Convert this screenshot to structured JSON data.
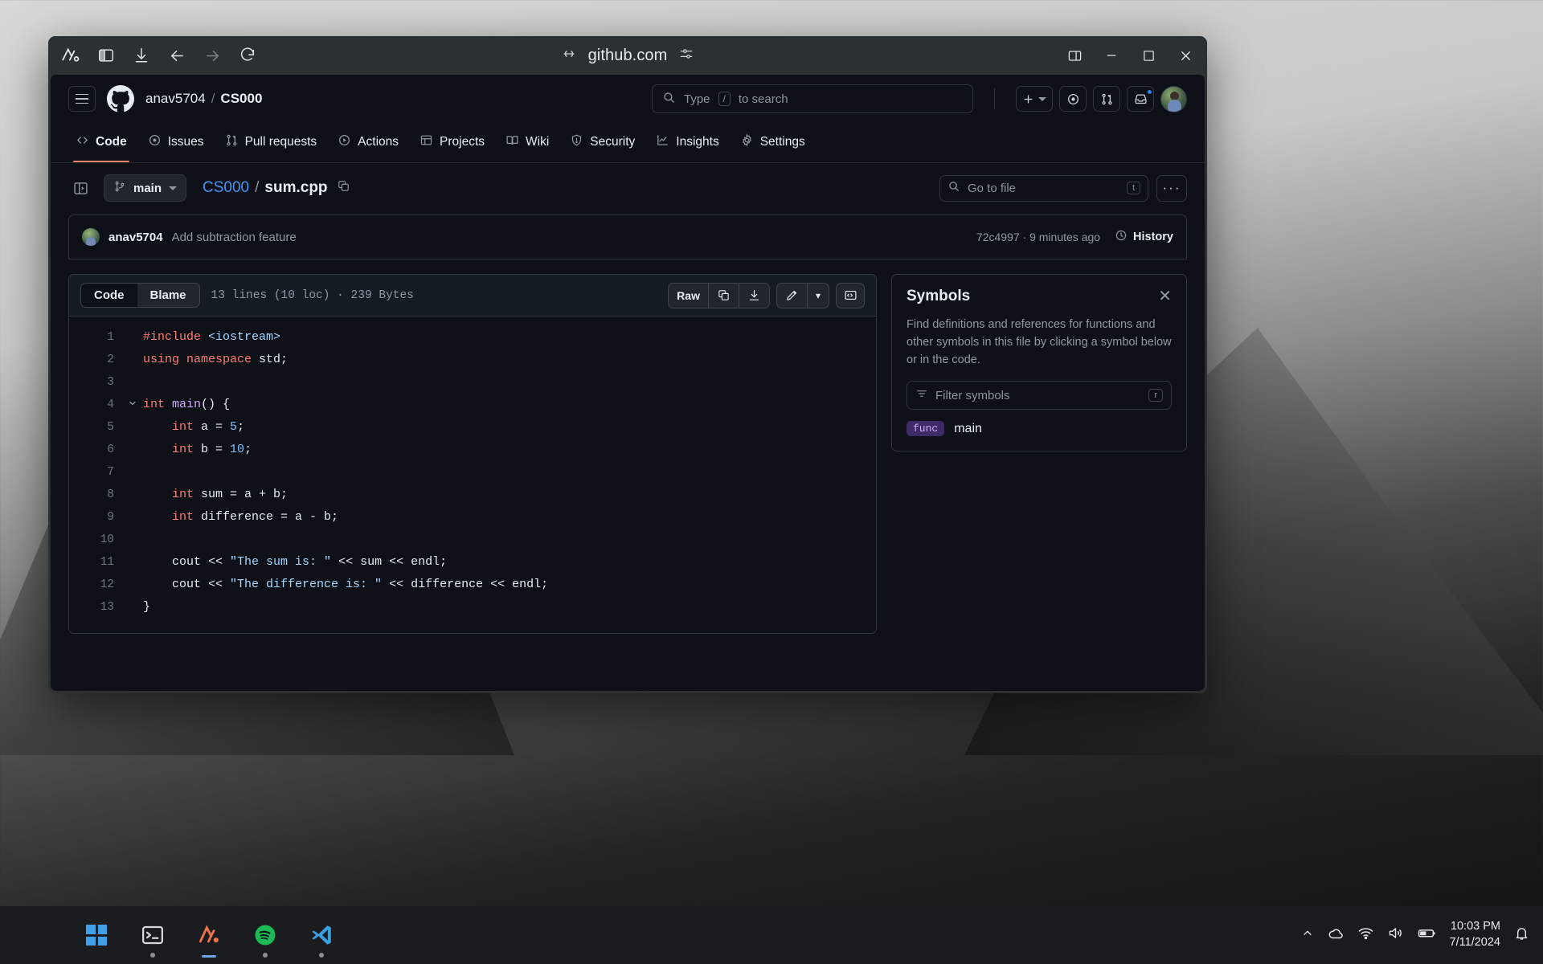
{
  "browser": {
    "url": "github.com",
    "toolbar_icons": [
      "arc-logo-icon",
      "sidebar-toggle-icon",
      "download-icon",
      "back-arrow-icon",
      "forward-arrow-icon",
      "reload-icon"
    ],
    "window_controls": [
      "split-view-icon",
      "minimize-icon",
      "maximize-icon",
      "close-icon"
    ]
  },
  "github": {
    "header": {
      "menu_label": "hamburger-menu",
      "owner": "anav5704",
      "separator": "/",
      "repo": "CS000",
      "search_prefix": "Type",
      "search_key": "/",
      "search_suffix": "to search",
      "search_placeholder": "Type / to search",
      "create_new_label": "+",
      "issues_icon": "issue-opened-icon",
      "pull_requests_icon": "git-pull-request-icon",
      "inbox_icon": "inbox-icon",
      "avatar_label": "user-avatar"
    },
    "nav": [
      {
        "label": "Code",
        "icon": "code-icon",
        "active": true
      },
      {
        "label": "Issues",
        "icon": "issue-opened-icon",
        "active": false
      },
      {
        "label": "Pull requests",
        "icon": "git-pull-request-icon",
        "active": false
      },
      {
        "label": "Actions",
        "icon": "play-icon",
        "active": false
      },
      {
        "label": "Projects",
        "icon": "table-icon",
        "active": false
      },
      {
        "label": "Wiki",
        "icon": "book-icon",
        "active": false
      },
      {
        "label": "Security",
        "icon": "shield-icon",
        "active": false
      },
      {
        "label": "Insights",
        "icon": "graph-icon",
        "active": false
      },
      {
        "label": "Settings",
        "icon": "gear-icon",
        "active": false
      }
    ],
    "file_bar": {
      "branch": "main",
      "path_repo": "CS000",
      "path_sep": "/",
      "path_file": "sum.cpp",
      "goto_file_placeholder": "Go to file",
      "goto_file_key": "t",
      "more_options": "···"
    },
    "commit": {
      "author": "anav5704",
      "message": "Add subtraction feature",
      "sha": "72c4997",
      "dot": "·",
      "relative_time": "9 minutes ago",
      "history_label": "History"
    },
    "code_card": {
      "tab_code": "Code",
      "tab_blame": "Blame",
      "meta": "13 lines (10 loc) · 239 Bytes",
      "raw_label": "Raw",
      "copy_icon": "copy-icon",
      "download_icon": "download-icon",
      "edit_icon": "pencil-icon",
      "edit_caret": "▾",
      "symbols_icon": "code-symbols-icon"
    },
    "code_lines": [
      {
        "n": "1",
        "fold": false,
        "tokens": [
          {
            "t": "#include ",
            "c": "pp"
          },
          {
            "t": "<iostream>",
            "c": "inc"
          }
        ]
      },
      {
        "n": "2",
        "fold": false,
        "tokens": [
          {
            "t": "using namespace ",
            "c": "k"
          },
          {
            "t": "std;",
            "c": "plain"
          }
        ]
      },
      {
        "n": "3",
        "fold": false,
        "tokens": []
      },
      {
        "n": "4",
        "fold": true,
        "tokens": [
          {
            "t": "int ",
            "c": "k"
          },
          {
            "t": "main",
            "c": "fn"
          },
          {
            "t": "() {",
            "c": "plain"
          }
        ]
      },
      {
        "n": "5",
        "fold": false,
        "tokens": [
          {
            "t": "    ",
            "c": "plain"
          },
          {
            "t": "int ",
            "c": "k"
          },
          {
            "t": "a = ",
            "c": "plain"
          },
          {
            "t": "5",
            "c": "num"
          },
          {
            "t": ";",
            "c": "plain"
          }
        ]
      },
      {
        "n": "6",
        "fold": false,
        "tokens": [
          {
            "t": "    ",
            "c": "plain"
          },
          {
            "t": "int ",
            "c": "k"
          },
          {
            "t": "b = ",
            "c": "plain"
          },
          {
            "t": "10",
            "c": "num"
          },
          {
            "t": ";",
            "c": "plain"
          }
        ]
      },
      {
        "n": "7",
        "fold": false,
        "tokens": []
      },
      {
        "n": "8",
        "fold": false,
        "tokens": [
          {
            "t": "    ",
            "c": "plain"
          },
          {
            "t": "int ",
            "c": "k"
          },
          {
            "t": "sum = a + b;",
            "c": "plain"
          }
        ]
      },
      {
        "n": "9",
        "fold": false,
        "tokens": [
          {
            "t": "    ",
            "c": "plain"
          },
          {
            "t": "int ",
            "c": "k"
          },
          {
            "t": "difference = a - b;",
            "c": "plain"
          }
        ]
      },
      {
        "n": "10",
        "fold": false,
        "tokens": []
      },
      {
        "n": "11",
        "fold": false,
        "tokens": [
          {
            "t": "    cout << ",
            "c": "plain"
          },
          {
            "t": "\"The sum is: \"",
            "c": "st"
          },
          {
            "t": " << sum << endl;",
            "c": "plain"
          }
        ]
      },
      {
        "n": "12",
        "fold": false,
        "tokens": [
          {
            "t": "    cout << ",
            "c": "plain"
          },
          {
            "t": "\"The difference is: \"",
            "c": "st"
          },
          {
            "t": " << difference << endl;",
            "c": "plain"
          }
        ]
      },
      {
        "n": "13",
        "fold": false,
        "tokens": [
          {
            "t": "}",
            "c": "plain"
          }
        ]
      }
    ],
    "symbols_panel": {
      "title": "Symbols",
      "close_label": "✕",
      "description": "Find definitions and references for functions and other symbols in this file by clicking a symbol below or in the code.",
      "filter_placeholder": "Filter symbols",
      "filter_key": "r",
      "items": [
        {
          "kind": "func",
          "name": "main"
        }
      ]
    },
    "colors": {
      "accent_active_tab": "#f78166",
      "link_blue": "#4493f8",
      "keyword_red": "#ff7b72",
      "string_blue": "#a5d6ff",
      "number_blue": "#79c0ff",
      "function_purple": "#d2a8ff",
      "page_bg": "#0d1117"
    }
  },
  "taskbar": {
    "start_label": "windows-start",
    "apps": [
      {
        "name": "terminal-icon",
        "active": false
      },
      {
        "name": "arc-browser-icon",
        "active": true
      },
      {
        "name": "spotify-icon",
        "active": false
      },
      {
        "name": "vscode-icon",
        "active": false
      }
    ],
    "tray": {
      "chevron": "^",
      "icons": [
        "onedrive-icon",
        "wifi-icon",
        "speaker-icon",
        "battery-icon"
      ],
      "time": "10:03 PM",
      "date": "7/11/2024",
      "notification_icon": "bell-icon"
    }
  }
}
